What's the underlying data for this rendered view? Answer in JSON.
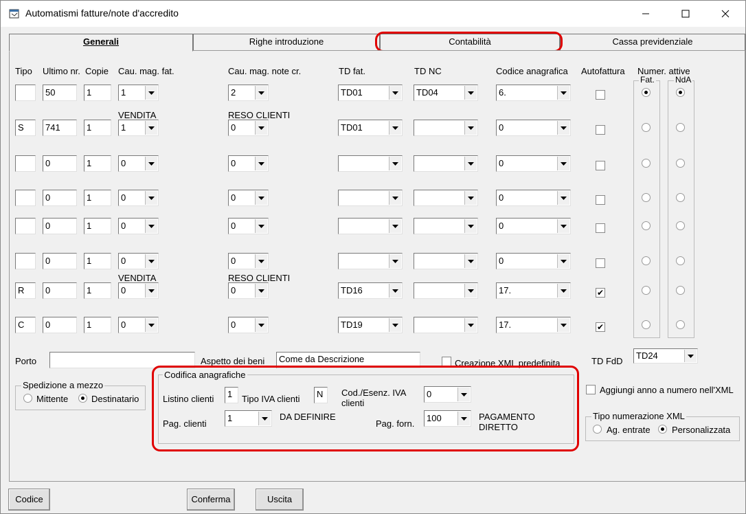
{
  "window": {
    "title": "Automatismi fatture/note d'accredito"
  },
  "tabs": [
    "Generali",
    "Righe introduzione",
    "Contabilità",
    "Cassa previdenziale"
  ],
  "headers": {
    "tipo": "Tipo",
    "ultimo": "Ultimo nr.",
    "copie": "Copie",
    "cau_fat": "Cau. mag. fat.",
    "cau_nc": "Cau. mag. note cr.",
    "td_fat": "TD fat.",
    "td_nc": "TD NC",
    "codice": "Codice anagrafica",
    "autofattura": "Autofattura",
    "numer": "Numer. attive",
    "fat": "Fat.",
    "nda": "NdA"
  },
  "rows": [
    {
      "tipo": "",
      "ultimo": "50",
      "copie": "1",
      "cau_fat": "1",
      "cau_nc": "2",
      "td_fat": "TD01",
      "td_nc": "TD04",
      "codice": "6.",
      "auto": false,
      "fat": true,
      "nda": true,
      "desc_fat": "",
      "desc_nc": ""
    },
    {
      "tipo": "S",
      "ultimo": "741",
      "copie": "1",
      "cau_fat": "1",
      "cau_nc": "0",
      "td_fat": "TD01",
      "td_nc": "",
      "codice": "0",
      "auto": false,
      "fat": false,
      "nda": false,
      "desc_fat": "VENDITA",
      "desc_nc": "RESO CLIENTI"
    },
    {
      "tipo": "",
      "ultimo": "0",
      "copie": "1",
      "cau_fat": "0",
      "cau_nc": "0",
      "td_fat": "",
      "td_nc": "",
      "codice": "0",
      "auto": false,
      "fat": false,
      "nda": false,
      "desc_fat": "",
      "desc_nc": ""
    },
    {
      "tipo": "",
      "ultimo": "0",
      "copie": "1",
      "cau_fat": "0",
      "cau_nc": "0",
      "td_fat": "",
      "td_nc": "",
      "codice": "0",
      "auto": false,
      "fat": false,
      "nda": false,
      "desc_fat": "",
      "desc_nc": ""
    },
    {
      "tipo": "",
      "ultimo": "0",
      "copie": "1",
      "cau_fat": "0",
      "cau_nc": "0",
      "td_fat": "",
      "td_nc": "",
      "codice": "0",
      "auto": false,
      "fat": false,
      "nda": false,
      "desc_fat": "",
      "desc_nc": ""
    },
    {
      "tipo": "",
      "ultimo": "0",
      "copie": "1",
      "cau_fat": "0",
      "cau_nc": "0",
      "td_fat": "",
      "td_nc": "",
      "codice": "0",
      "auto": false,
      "fat": false,
      "nda": false,
      "desc_fat": "",
      "desc_nc": ""
    },
    {
      "tipo": "R",
      "ultimo": "0",
      "copie": "1",
      "cau_fat": "0",
      "cau_nc": "0",
      "td_fat": "TD16",
      "td_nc": "",
      "codice": "17.",
      "auto": true,
      "fat": false,
      "nda": false,
      "desc_fat": "VENDITA",
      "desc_nc": "RESO CLIENTI"
    },
    {
      "tipo": "C",
      "ultimo": "0",
      "copie": "1",
      "cau_fat": "0",
      "cau_nc": "0",
      "td_fat": "TD19",
      "td_nc": "",
      "codice": "17.",
      "auto": true,
      "fat": false,
      "nda": false,
      "desc_fat": "",
      "desc_nc": ""
    }
  ],
  "porto": {
    "label": "Porto",
    "value": ""
  },
  "aspetto": {
    "label": "Aspetto dei beni",
    "value": "Come da Descrizione"
  },
  "creazione_xml": {
    "label": "Creazione XML predefinita",
    "checked": false
  },
  "td_fdd": {
    "label": "TD FdD",
    "value": "TD24"
  },
  "spedizione": {
    "title": "Spedizione a mezzo",
    "mittente": "Mittente",
    "destinatario": "Destinatario",
    "selected": "Destinatario"
  },
  "codifica": {
    "title": "Codifica anagrafiche",
    "listino_label": "Listino clienti",
    "listino_value": "1",
    "tipo_iva_label": "Tipo IVA clienti",
    "tipo_iva_value": "N",
    "cod_esenz_label1": "Cod./Esenz. IVA",
    "cod_esenz_label2": "clienti",
    "cod_esenz_value": "0",
    "pag_clienti_label": "Pag. clienti",
    "pag_clienti_value": "1",
    "pag_clienti_desc": "DA DEFINIRE",
    "pag_forn_label": "Pag. forn.",
    "pag_forn_value": "100",
    "pag_forn_desc1": "PAGAMENTO",
    "pag_forn_desc2": "DIRETTO"
  },
  "aggiungi_anno": {
    "label": "Aggiungi anno a numero nell'XML",
    "checked": false
  },
  "tipo_num_xml": {
    "title": "Tipo numerazione XML",
    "ag_entrate": "Ag. entrate",
    "personalizzata": "Personalizzata",
    "selected": "Personalizzata"
  },
  "buttons": {
    "codice": "Codice",
    "conferma": "Conferma",
    "uscita": "Uscita"
  },
  "colors": {
    "highlight": "#e00000"
  },
  "icons": {
    "app": "app-window-icon",
    "min": "minimize-icon",
    "max": "maximize-icon",
    "close": "close-icon",
    "dropdown": "chevron-down-icon"
  }
}
